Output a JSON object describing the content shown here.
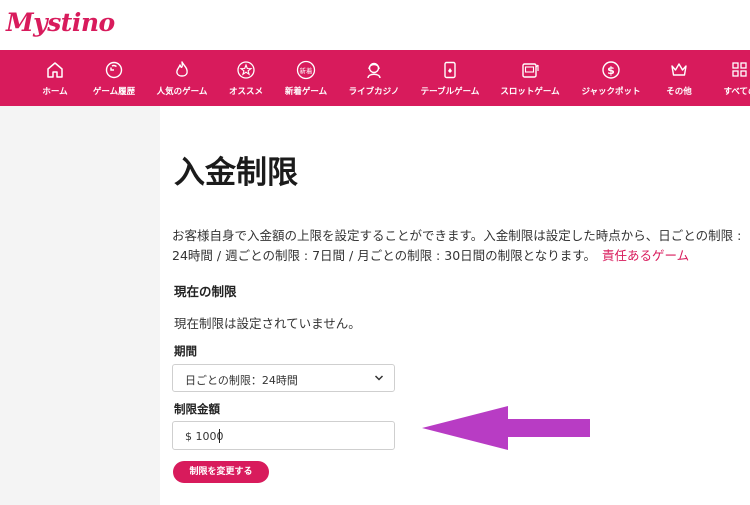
{
  "brand": {
    "logo_text": "Mystino",
    "accent_color": "#d81b5c"
  },
  "nav": {
    "items": [
      {
        "label": "ホーム",
        "icon": "home-icon"
      },
      {
        "label": "ゲーム履歴",
        "icon": "history-icon"
      },
      {
        "label": "人気のゲーム",
        "icon": "flame-icon"
      },
      {
        "label": "オススメ",
        "icon": "star-icon"
      },
      {
        "label": "新着ゲーム",
        "icon": "new-badge-icon",
        "icon_text": "新着"
      },
      {
        "label": "ライブカジノ",
        "icon": "dealer-icon"
      },
      {
        "label": "テーブルゲーム",
        "icon": "cards-icon"
      },
      {
        "label": "スロットゲーム",
        "icon": "slot-machine-icon"
      },
      {
        "label": "ジャックポット",
        "icon": "dollar-coin-icon"
      },
      {
        "label": "その他",
        "icon": "crown-icon"
      },
      {
        "label": "すべての",
        "icon": "grid-icon"
      }
    ]
  },
  "page": {
    "title": "入金制限",
    "description": "お客様自身で入金額の上限を設定することができます。入金制限は設定した時点から、日ごとの制限 : 24時間 / 週ごとの制限 : 7日間 / 月ごとの制限 : 30日間の制限となります。",
    "responsible_link": "責任あるゲーム",
    "current_heading": "現在の制限",
    "current_text": "現在制限は設定されていません。",
    "period_label": "期間",
    "period_value": "日ごとの制限：24時間",
    "amount_label": "制限金額",
    "amount_value": "$ 1000",
    "submit_label": "制限を変更する"
  },
  "annotation": {
    "arrow_color": "#b83cc4"
  }
}
